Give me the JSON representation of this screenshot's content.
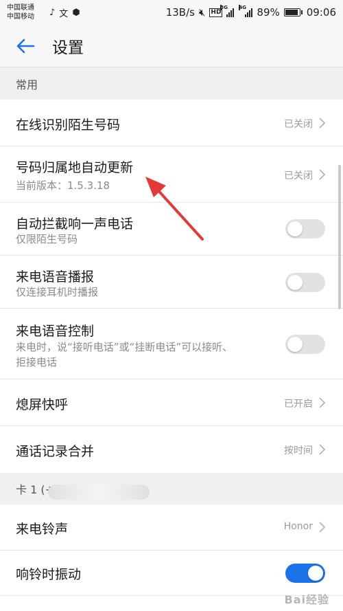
{
  "status_bar": {
    "carrier_1": "中国联通",
    "carrier_2": "中国移动",
    "speed": "13B/s",
    "hd": "HD",
    "net_1": "3G",
    "net_2": "4G",
    "battery": "89%",
    "battery_level": 0.89,
    "time": "09:06"
  },
  "header": {
    "title": "设置"
  },
  "sections": {
    "common": "常用",
    "card1": "卡 1 (+"
  },
  "items": {
    "identify_unknown": {
      "label": "在线识别陌生号码",
      "value": "已关闭"
    },
    "auto_update": {
      "label": "号码归属地自动更新",
      "subtitle": "当前版本：1.5.3.18",
      "value": "已关闭"
    },
    "block_one_ring": {
      "label": "自动拦截响一声电话",
      "subtitle": "仅限陌生号码",
      "on": false
    },
    "voice_broadcast": {
      "label": "来电语音播报",
      "subtitle": "仅连接耳机时播报",
      "on": false
    },
    "voice_control": {
      "label": "来电语音控制",
      "subtitle_line1": "来电时，说“接听电话”或“挂断电话”可以接听、",
      "subtitle_line2": "拒接电话",
      "on": false
    },
    "screen_off_call": {
      "label": "熄屏快呼",
      "value": "已开启"
    },
    "merge_log": {
      "label": "通话记录合并",
      "value": "按时间"
    },
    "ringtone": {
      "label": "来电铃声",
      "value": "Honor"
    },
    "vibrate": {
      "label": "响铃时振动",
      "on": true
    }
  },
  "watermark": {
    "text": "Bai经验"
  },
  "colors": {
    "accent": "#1a73e8",
    "annotation_arrow": "#e53935"
  }
}
